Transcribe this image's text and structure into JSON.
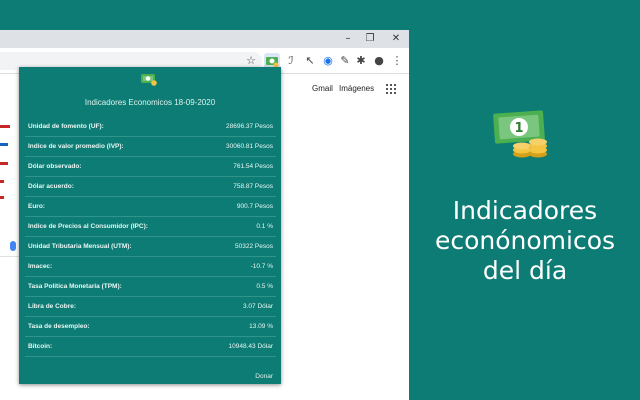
{
  "browser": {
    "window_controls": [
      "–",
      "❐",
      "✕"
    ],
    "toolbar_icons": [
      "star-icon",
      "extension-indicadores-icon",
      "extension-2-icon",
      "extension-cursor-icon",
      "extension-circle-icon",
      "pen-icon",
      "puzzle-icon",
      "account-icon",
      "menu-icon"
    ],
    "toolbar_glyphs": [
      "☆",
      "",
      "ℐ",
      "↖",
      "◉",
      "✎",
      "✱",
      "●",
      "⋮"
    ],
    "links": {
      "gmail": "Gmail",
      "imagenes": "Imágenes"
    }
  },
  "popup": {
    "title": "Indicadores Economicos 18-09-2020",
    "indicators": [
      {
        "label": "Unidad de fomento (UF):",
        "value": "28696.37 Pesos"
      },
      {
        "label": "Indice de valor promedio (IVP):",
        "value": "30060.81 Pesos"
      },
      {
        "label": "Dólar observado:",
        "value": "761.54 Pesos"
      },
      {
        "label": "Dólar acuerdo:",
        "value": "758.87 Pesos"
      },
      {
        "label": "Euro:",
        "value": "900.7 Pesos"
      },
      {
        "label": "Indice de Precios al Consumidor (IPC):",
        "value": "0.1 %"
      },
      {
        "label": "Unidad Tributaria Mensual (UTM):",
        "value": "50322 Pesos"
      },
      {
        "label": "Imacec:",
        "value": "-10.7 %"
      },
      {
        "label": "Tasa Política Monetaria (TPM):",
        "value": "0.5 %"
      },
      {
        "label": "Libra de Cobre:",
        "value": "3.07 Dólar"
      },
      {
        "label": "Tasa de desempleo:",
        "value": "13.09 %"
      },
      {
        "label": "Bitcoin:",
        "value": "10948.43 Dólar"
      }
    ],
    "donar": "Donar"
  },
  "promo": {
    "lines": [
      "Indicadores",
      "econónomicos",
      "del día"
    ],
    "logo_digit": "1"
  },
  "colors": {
    "background": "#0c7c74",
    "money_green": "#4caf50",
    "coin_gold": "#f5c542"
  }
}
